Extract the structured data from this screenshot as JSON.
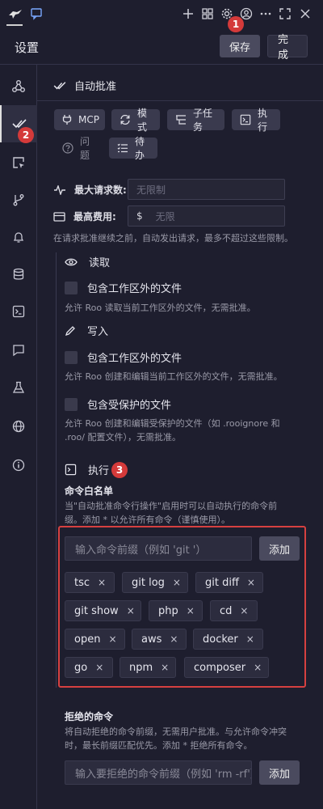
{
  "header": {
    "title": "设置",
    "save_label": "保存",
    "done_label": "完成"
  },
  "badges": {
    "b1": "1",
    "b2": "2",
    "b3": "3"
  },
  "section": {
    "title": "自动批准"
  },
  "chips": [
    {
      "label": "MCP",
      "icon": "plug-icon"
    },
    {
      "label": "模式",
      "icon": "refresh-icon"
    },
    {
      "label": "子任务",
      "icon": "list-tree-icon"
    },
    {
      "label": "执行",
      "icon": "terminal-icon"
    },
    {
      "label": "问题",
      "icon": "question-icon"
    },
    {
      "label": "待办",
      "icon": "checklist-icon"
    }
  ],
  "limits": {
    "max_requests_label": "最大请求数:",
    "max_requests_placeholder": "无限制",
    "max_cost_label": "最高费用:",
    "currency": "$",
    "max_cost_placeholder": "无限",
    "hint": "在请求批准继续之前，自动发出请求，最多不超过这些限制。"
  },
  "read": {
    "title": "读取",
    "outside_label": "包含工作区外的文件",
    "outside_hint": "允许 Roo 读取当前工作区外的文件，无需批准。"
  },
  "write": {
    "title": "写入",
    "outside_label": "包含工作区外的文件",
    "outside_hint": "允许 Roo 创建和编辑当前工作区外的文件，无需批准。",
    "protected_label": "包含受保护的文件",
    "protected_hint_1": "允许 Roo 创建和编辑受保护的文件（如 .rooignore 和",
    "protected_hint_2": ".roo/ 配置文件），无需批准。"
  },
  "execute": {
    "title": "执行",
    "whitelist_title": "命令白名单",
    "whitelist_hint_1": "当\"自动批准命令行操作\"启用时可以自动执行的命令前",
    "whitelist_hint_2": "缀。添加 * 以允许所有命令（谨慎使用）。",
    "input_placeholder": "输入命令前缀（例如 'git '）",
    "add_label": "添加",
    "commands": [
      "tsc",
      "git log",
      "git diff",
      "git show",
      "php",
      "cd",
      "open",
      "aws",
      "docker",
      "go",
      "npm",
      "composer"
    ],
    "remove_glyph": "×",
    "denied_title": "拒绝的命令",
    "denied_hint_1": "将自动拒绝的命令前缀，无需用户批准。与允许命令冲突",
    "denied_hint_2": "时，最长前缀匹配优先。添加 * 拒绝所有命令。",
    "denied_placeholder": "输入要拒绝的命令前缀（例如 'rm -rf'）",
    "denied_add_label": "添加"
  },
  "colors": {
    "background": "#1e1e2e",
    "badge": "#d43a3a",
    "highlight_box": "#d64040"
  }
}
